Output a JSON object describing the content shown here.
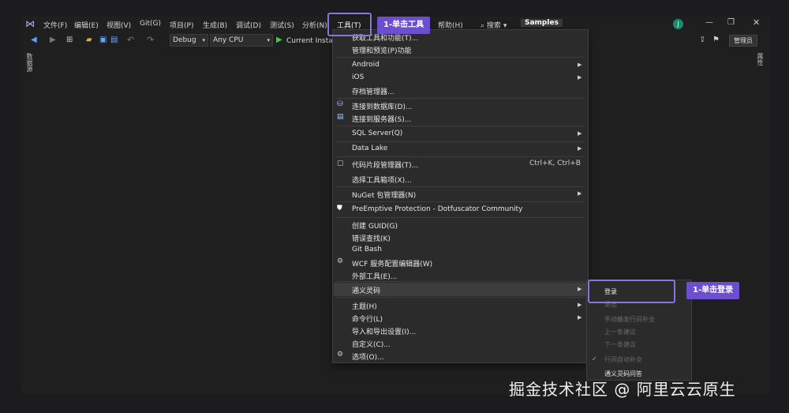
{
  "menubar": {
    "items": [
      "文件(F)",
      "编辑(E)",
      "视图(V)",
      "Git(G)",
      "项目(P)",
      "生成(B)",
      "调试(D)",
      "测试(S)",
      "分析(N)",
      "工具(T)",
      "帮助(H)"
    ],
    "search": "搜索",
    "search_caret": "▾",
    "solution": "Samples",
    "avatar": "J"
  },
  "toolbar": {
    "config": "Debug",
    "platform": "Any CPU",
    "run": "Current Instan",
    "admin": "管理员"
  },
  "side": {
    "left": "数据源",
    "right": "属性"
  },
  "tools_menu": {
    "items": [
      {
        "label": "获取工具和功能(T)..."
      },
      {
        "label": "管理和预览(P)功能"
      },
      {
        "label": "Android"
      },
      {
        "label": "iOS"
      },
      {
        "label": "存档管理器..."
      },
      {
        "label": "连接到数据库(D)..."
      },
      {
        "label": "连接到服务器(S)..."
      },
      {
        "label": "SQL Server(Q)"
      },
      {
        "label": "Data Lake"
      },
      {
        "label": "代码片段管理器(T)...",
        "shortcut": "Ctrl+K, Ctrl+B"
      },
      {
        "label": "选择工具箱项(X)..."
      },
      {
        "label": "NuGet 包管理器(N)"
      },
      {
        "label": "PreEmptive Protection - Dotfuscator Community"
      },
      {
        "label": "创建 GUID(G)"
      },
      {
        "label": "错误查找(K)"
      },
      {
        "label": "Git Bash"
      },
      {
        "label": "WCF 服务配置编辑器(W)"
      },
      {
        "label": "外部工具(E)..."
      },
      {
        "label": "通义灵码"
      },
      {
        "label": "主题(H)"
      },
      {
        "label": "命令行(L)"
      },
      {
        "label": "导入和导出设置(I)..."
      },
      {
        "label": "自定义(C)..."
      },
      {
        "label": "选项(O)..."
      }
    ]
  },
  "submenu": {
    "items": [
      "登录",
      "退出",
      "手动触发行间补全",
      "上一条建议",
      "下一条建议",
      "行间自动补全",
      "通义灵码问答"
    ],
    "check": "✓"
  },
  "callouts": {
    "tools": "1-单击工具",
    "login": "1-单击登录"
  },
  "watermark": "掘金技术社区 @ 阿里云云原生"
}
